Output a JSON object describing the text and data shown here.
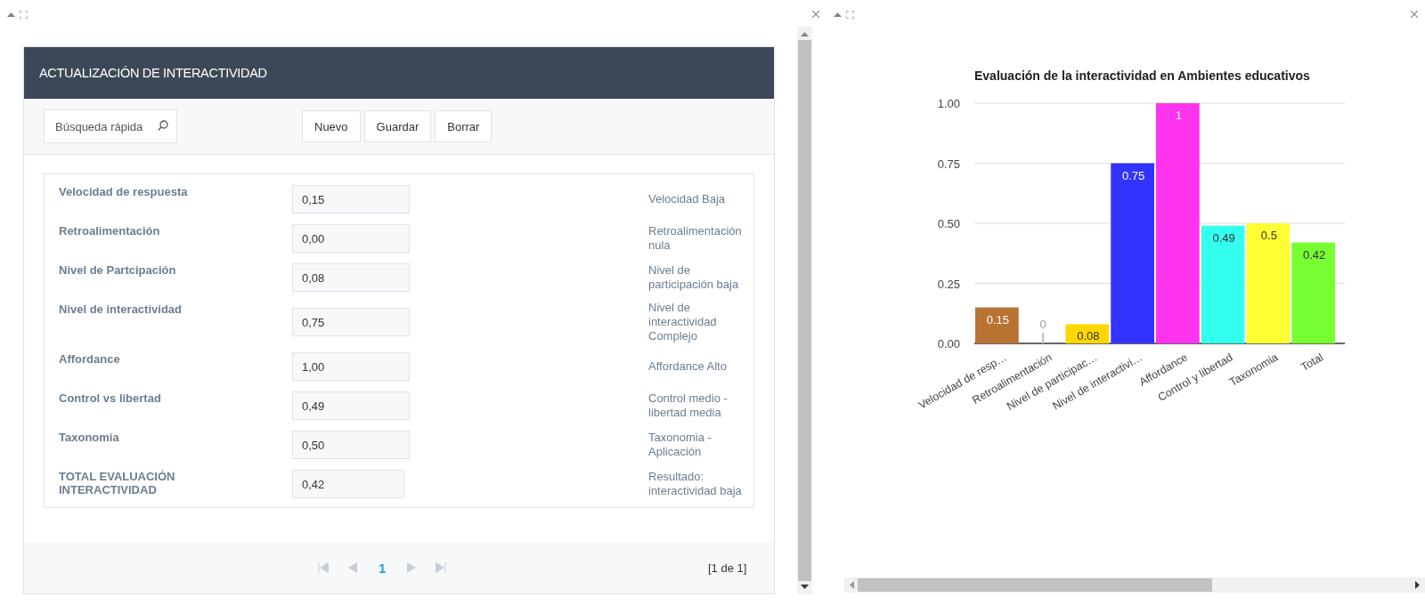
{
  "form_panel": {
    "title": "ACTUALIZACIÓN DE INTERACTIVIDAD",
    "search": {
      "placeholder": "Búsqueda rápida"
    },
    "buttons": [
      "Nuevo",
      "Guardar",
      "Borrar"
    ],
    "fields": [
      {
        "label": "Velocidad de respuesta",
        "value": "0,15",
        "result": "Velocidad Baja"
      },
      {
        "label": "Retroalimentación",
        "value": "0,00",
        "result": "Retroalimentación nula"
      },
      {
        "label": "Nivel de Partcipación",
        "value": "0,08",
        "result": "Nivel de participación baja"
      },
      {
        "label": "Nivel de interactividad",
        "value": "0,75",
        "result": "Nivel de interactividad Complejo"
      },
      {
        "label": "Affordance",
        "value": "1,00",
        "result": "Affordance Alto"
      },
      {
        "label": "Control vs libertad",
        "value": "0,49",
        "result": "Control medio - libertad media"
      },
      {
        "label": "Taxonomia",
        "value": "0,50",
        "result": "Taxonomia - Aplicación"
      },
      {
        "label": "TOTAL EVALUACIÓN INTERACTIVIDAD",
        "value": "0,42",
        "result": "Resultado: interactividad baja"
      }
    ],
    "pager": {
      "pages": [
        {
          "label": "1",
          "selected": true
        }
      ],
      "summary": "[1 de 1]"
    }
  },
  "chart_panel": {
    "chart_data": {
      "type": "bar",
      "title": "Evaluación de la interactividad en Ambientes educativos",
      "categories": [
        "Velocidad de resp…",
        "Retroalimentación",
        "Nivel de participac…",
        "Nivel de interactivi…",
        "Affordance",
        "Control y libertad",
        "Taxonomia",
        "Total"
      ],
      "stacked": true,
      "grid": true,
      "series": [
        {
          "color": "#b87333",
          "values": [
            0.15,
            null,
            null,
            null,
            null,
            null,
            null,
            null
          ]
        },
        {
          "color": "#c0c0c0",
          "values": [
            null,
            0,
            null,
            null,
            null,
            null,
            null,
            null
          ]
        },
        {
          "color": "#ffd700",
          "values": [
            null,
            null,
            0.08,
            null,
            null,
            null,
            null,
            null
          ]
        },
        {
          "color": "#3333ff",
          "values": [
            null,
            null,
            null,
            0.75,
            null,
            null,
            null,
            null
          ]
        },
        {
          "color": "#ff33ee",
          "values": [
            null,
            null,
            null,
            null,
            1,
            null,
            null,
            null
          ]
        },
        {
          "color": "#33ffee",
          "values": [
            null,
            null,
            null,
            null,
            null,
            0.49,
            null,
            null
          ]
        },
        {
          "color": "#ffff33",
          "values": [
            null,
            null,
            null,
            null,
            null,
            null,
            0.5,
            null
          ]
        },
        {
          "color": "#77ff33",
          "values": [
            null,
            null,
            null,
            null,
            null,
            null,
            null,
            0.42
          ]
        }
      ],
      "ylim": [
        0,
        1
      ],
      "yticks": [
        {
          "value": 0,
          "label": "0.00"
        },
        {
          "value": 0.25,
          "label": "0.25"
        },
        {
          "value": 0.5,
          "label": "0.50"
        },
        {
          "value": 0.75,
          "label": "0.75"
        },
        {
          "value": 1,
          "label": "1.00"
        }
      ],
      "value_labels": [
        "0.15",
        "0",
        "0.08",
        "0.75",
        "1",
        "0.49",
        "0.5",
        "0.42"
      ]
    }
  }
}
